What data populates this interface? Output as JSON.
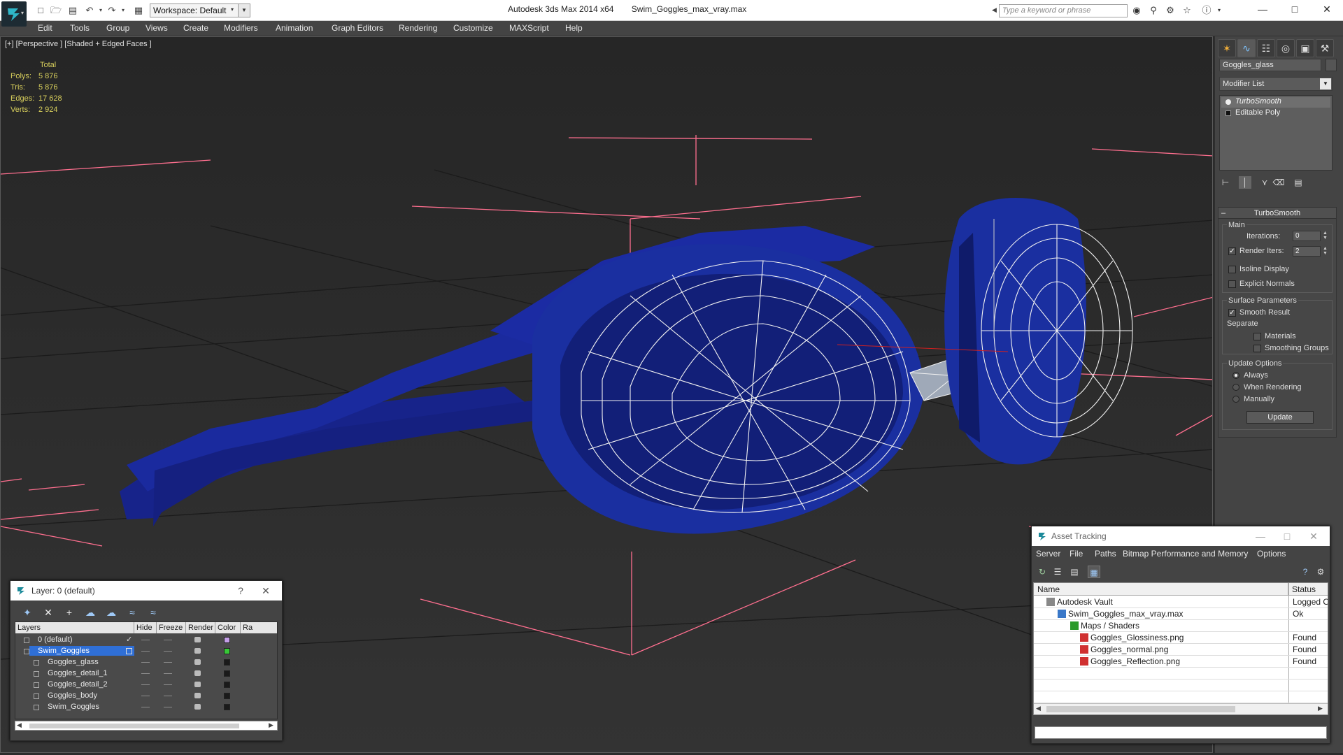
{
  "app": {
    "title": "Autodesk 3ds Max  2014 x64",
    "file": "Swim_Goggles_max_vray.max",
    "workspace": "Workspace: Default",
    "search_placeholder": "Type a keyword or phrase"
  },
  "menu": [
    "Edit",
    "Tools",
    "Group",
    "Views",
    "Create",
    "Modifiers",
    "Animation",
    "Graph Editors",
    "Rendering",
    "Customize",
    "MAXScript",
    "Help"
  ],
  "viewport": {
    "label": "[+] [Perspective ] [Shaded + Edged Faces ]",
    "stats": {
      "header": "Total",
      "rows": [
        {
          "label": "Polys:",
          "value": "5 876"
        },
        {
          "label": "Tris:",
          "value": "5 876"
        },
        {
          "label": "Edges:",
          "value": "17 628"
        },
        {
          "label": "Verts:",
          "value": "2 924"
        }
      ]
    },
    "colors": {
      "object": "#1a2fa0",
      "wire": "#ffffff",
      "grid": "#1a1a1a",
      "gizmo": "#ff6f8f"
    }
  },
  "command_panel": {
    "object_name": "Goggles_glass",
    "modifier_list": "Modifier List",
    "stack": [
      "TurboSmooth",
      "Editable Poly"
    ],
    "rollout_title": "TurboSmooth",
    "main_label": "Main",
    "iterations_label": "Iterations:",
    "iterations_value": "0",
    "render_iters_label": "Render Iters:",
    "render_iters_value": "2",
    "isoline_label": "Isoline Display",
    "explicit_normals_label": "Explicit Normals",
    "surface_params_label": "Surface Parameters",
    "smooth_result_label": "Smooth Result",
    "separate_label": "Separate",
    "materials_label": "Materials",
    "smoothing_groups_label": "Smoothing Groups",
    "update_options_label": "Update Options",
    "always_label": "Always",
    "when_rendering_label": "When Rendering",
    "manually_label": "Manually",
    "update_button": "Update"
  },
  "layer_dialog": {
    "title": "Layer: 0 (default)",
    "columns": [
      "Layers",
      "Hide",
      "Freeze",
      "Render",
      "Color",
      "Ra"
    ],
    "rows": [
      {
        "name": "0 (default)",
        "color": "#c49ee8"
      },
      {
        "name": "Swim_Goggles",
        "color": "#37c837"
      },
      {
        "name": "Goggles_glass",
        "color": "#1a1a1a"
      },
      {
        "name": "Goggles_detail_1",
        "color": "#1a1a1a"
      },
      {
        "name": "Goggles_detail_2",
        "color": "#1a1a1a"
      },
      {
        "name": "Goggles_body",
        "color": "#1a1a1a"
      },
      {
        "name": "Swim_Goggles",
        "color": "#1a1a1a"
      }
    ]
  },
  "asset_tracking": {
    "title": "Asset Tracking",
    "menu": [
      "Server",
      "File",
      "Paths",
      "Bitmap Performance and Memory",
      "Options"
    ],
    "col_name": "Name",
    "col_status": "Status",
    "rows": [
      {
        "name": "Autodesk Vault",
        "status": "Logged O"
      },
      {
        "name": "Swim_Goggles_max_vray.max",
        "status": "Ok"
      },
      {
        "name": "Maps / Shaders",
        "status": ""
      },
      {
        "name": "Goggles_Glossiness.png",
        "status": "Found"
      },
      {
        "name": "Goggles_normal.png",
        "status": "Found"
      },
      {
        "name": "Goggles_Reflection.png",
        "status": "Found"
      }
    ]
  }
}
